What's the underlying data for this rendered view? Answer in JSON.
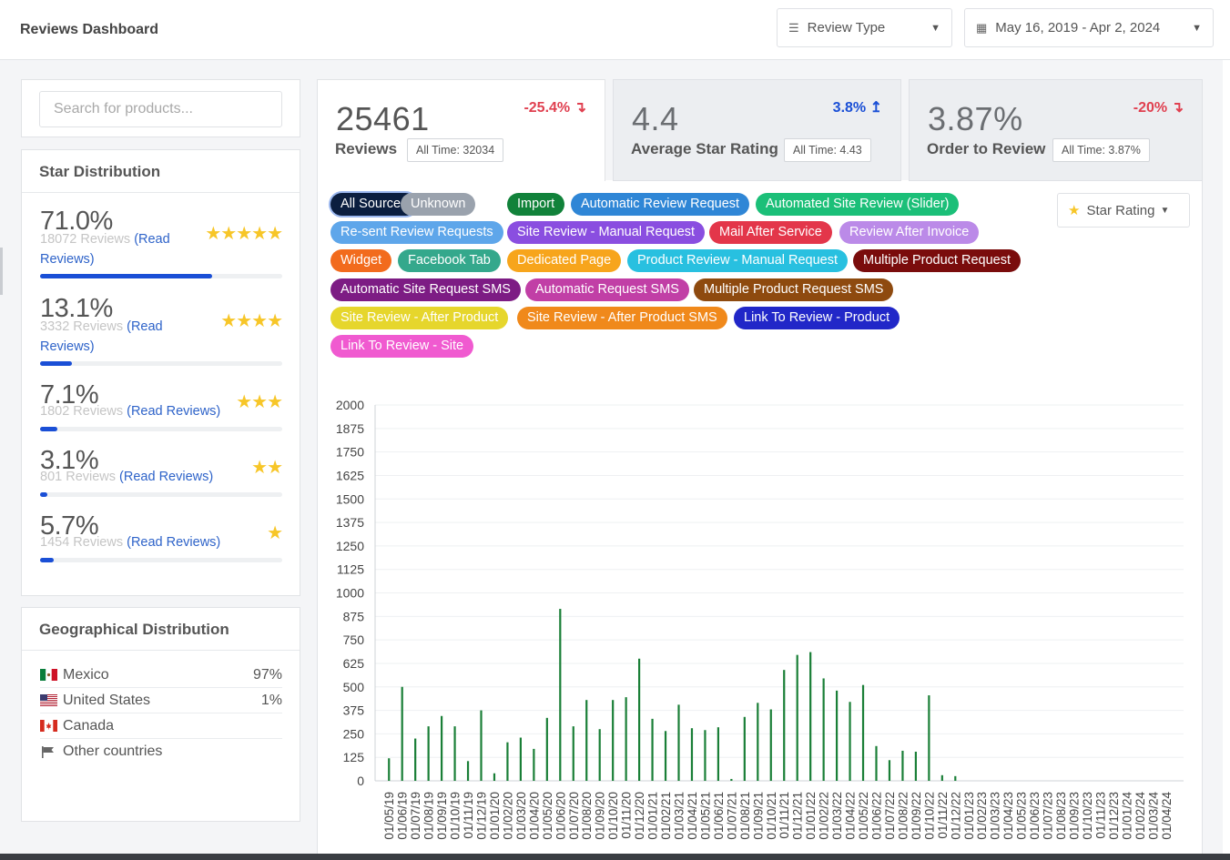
{
  "header": {
    "title": "Reviews Dashboard",
    "review_type_label": "Review Type",
    "date_range": "May 16, 2019 - Apr 2, 2024"
  },
  "search": {
    "placeholder": "Search for products..."
  },
  "star_distribution": {
    "title": "Star Distribution",
    "rows": [
      {
        "pct": "71.0%",
        "count": "18072 Reviews",
        "link": "(Read Reviews)",
        "stars": 5,
        "fill": 0.71
      },
      {
        "pct": "13.1%",
        "count": "3332 Reviews",
        "link": "(Read Reviews)",
        "stars": 4,
        "fill": 0.131
      },
      {
        "pct": "7.1%",
        "count": "1802 Reviews",
        "link": "(Read Reviews)",
        "stars": 3,
        "fill": 0.071
      },
      {
        "pct": "3.1%",
        "count": "801 Reviews",
        "link": "(Read Reviews)",
        "stars": 2,
        "fill": 0.031
      },
      {
        "pct": "5.7%",
        "count": "1454 Reviews",
        "link": "(Read Reviews)",
        "stars": 1,
        "fill": 0.057
      }
    ]
  },
  "geo": {
    "title": "Geographical Distribution",
    "rows": [
      {
        "country": "Mexico",
        "pct": "97%",
        "flag": "mexico-flag"
      },
      {
        "country": "United States",
        "pct": "1%",
        "flag": "us-flag"
      },
      {
        "country": "Canada",
        "pct": "",
        "flag": "canada-flag"
      },
      {
        "country": "Other countries",
        "pct": "",
        "flag": "generic-flag"
      }
    ]
  },
  "stats": [
    {
      "value": "25461",
      "label": "Reviews",
      "all_time": "All Time: 32034",
      "change": "-25.4% ↴",
      "dir": "neg"
    },
    {
      "value": "4.4",
      "label": "Average Star Rating",
      "all_time": "All Time: 4.43",
      "change": "3.8% ↥",
      "dir": "pos"
    },
    {
      "value": "3.87%",
      "label": "Order to Review",
      "all_time": "All Time: 3.87%",
      "change": "-20% ↴",
      "dir": "neg"
    }
  ],
  "sources": [
    {
      "label": "All Sources",
      "color": "#0b1e3f",
      "selected": true
    },
    {
      "label": "Unknown",
      "color": "#9aa2ad"
    },
    {
      "label": "Import",
      "color": "#11823a"
    },
    {
      "label": "Automatic Review Request",
      "color": "#2f86d6"
    },
    {
      "label": "Automated Site Review (Slider)",
      "color": "#1bbf78"
    },
    {
      "label": "Re-sent Review Requests",
      "color": "#5ea6ea"
    },
    {
      "label": "Site Review - Manual Request",
      "color": "#8a4ee0"
    },
    {
      "label": "Mail After Service",
      "color": "#e3364a"
    },
    {
      "label": "Review After Invoice",
      "color": "#bb8ae8"
    },
    {
      "label": "Widget",
      "color": "#f26b1d"
    },
    {
      "label": "Facebook Tab",
      "color": "#34a88c"
    },
    {
      "label": "Dedicated Page",
      "color": "#f7a51c"
    },
    {
      "label": "Product Review - Manual Request",
      "color": "#28c0e0"
    },
    {
      "label": "Multiple Product Request",
      "color": "#7a0c0c"
    },
    {
      "label": "Automatic Site Request SMS",
      "color": "#7d1c84"
    },
    {
      "label": "Automatic Request SMS",
      "color": "#c13fa6"
    },
    {
      "label": "Multiple Product Request SMS",
      "color": "#8e4a0f"
    },
    {
      "label": "Site Review - After Product",
      "color": "#e6d62c"
    },
    {
      "label": "Site Review - After Product SMS",
      "color": "#f0891b"
    },
    {
      "label": "Link To Review - Product",
      "color": "#2127c8"
    },
    {
      "label": "Link To Review - Site",
      "color": "#f05ad0"
    }
  ],
  "star_rating_label": "Star Rating",
  "chart_data": {
    "type": "bar",
    "stacked": true,
    "ylim": [
      0,
      2000
    ],
    "yticks": [
      0,
      125,
      250,
      375,
      500,
      625,
      750,
      875,
      1000,
      1125,
      1250,
      1375,
      1500,
      1625,
      1750,
      1875,
      2000
    ],
    "categories": [
      "01/05/19",
      "01/06/19",
      "01/07/19",
      "01/08/19",
      "01/09/19",
      "01/10/19",
      "01/11/19",
      "01/12/19",
      "01/01/20",
      "01/02/20",
      "01/03/20",
      "01/04/20",
      "01/05/20",
      "01/06/20",
      "01/07/20",
      "01/08/20",
      "01/09/20",
      "01/10/20",
      "01/11/20",
      "01/12/20",
      "01/01/21",
      "01/02/21",
      "01/03/21",
      "01/04/21",
      "01/05/21",
      "01/06/21",
      "01/07/21",
      "01/08/21",
      "01/09/21",
      "01/10/21",
      "01/11/21",
      "01/12/21",
      "01/01/22",
      "01/02/22",
      "01/03/22",
      "01/04/22",
      "01/05/22",
      "01/06/22",
      "01/07/22",
      "01/08/22",
      "01/09/22",
      "01/10/22",
      "01/11/22",
      "01/12/22",
      "01/01/23",
      "01/02/23",
      "01/03/23",
      "01/04/23",
      "01/05/23",
      "01/06/23",
      "01/07/23",
      "01/08/23",
      "01/09/23",
      "01/10/23",
      "01/11/23",
      "01/12/23",
      "01/01/24",
      "01/02/24",
      "01/03/24",
      "01/04/24"
    ],
    "series": [
      {
        "color": "#1a7f37",
        "values": [
          120,
          500,
          225,
          290,
          345,
          290,
          105,
          375,
          40,
          205,
          230,
          170,
          335,
          915,
          290,
          430,
          275,
          430,
          445,
          650,
          330,
          265,
          405,
          280,
          270,
          285,
          10,
          340,
          415,
          380,
          590,
          670,
          685,
          545,
          480,
          420,
          510,
          185,
          110,
          160,
          155,
          455,
          30,
          25,
          0,
          0,
          0,
          0,
          0,
          0,
          0,
          0,
          0,
          0,
          0,
          0,
          0,
          0,
          0,
          0
        ]
      },
      {
        "color": "#e6cf1f",
        "values": [
          0,
          0,
          0,
          0,
          0,
          0,
          0,
          0,
          0,
          0,
          0,
          0,
          0,
          0,
          0,
          0,
          0,
          0,
          0,
          0,
          0,
          0,
          0,
          0,
          0,
          0,
          0,
          0,
          0,
          0,
          0,
          0,
          0,
          0,
          0,
          0,
          0,
          0,
          0,
          0,
          0,
          0,
          0,
          0,
          0,
          0,
          0,
          0,
          0,
          0,
          0,
          0,
          0,
          0,
          0,
          0,
          0,
          0,
          0,
          0
        ]
      },
      {
        "color": "#8c1010",
        "values": [
          0,
          0,
          0,
          0,
          0,
          0,
          0,
          0,
          0,
          0,
          0,
          0,
          0,
          0,
          0,
          0,
          0,
          0,
          0,
          0,
          0,
          0,
          0,
          0,
          0,
          0,
          0,
          0,
          0,
          0,
          0,
          0,
          0,
          0,
          0,
          0,
          0,
          0,
          0,
          0,
          0,
          0,
          0,
          0,
          0,
          0,
          0,
          0,
          0,
          0,
          0,
          0,
          0,
          0,
          0,
          0,
          0,
          0,
          0,
          0
        ]
      },
      {
        "color": "#3f86d4",
        "values": [
          0,
          0,
          0,
          0,
          0,
          0,
          0,
          0,
          0,
          0,
          0,
          0,
          0,
          0,
          0,
          0,
          0,
          0,
          0,
          0,
          0,
          0,
          0,
          0,
          0,
          0,
          0,
          0,
          0,
          0,
          0,
          0,
          0,
          0,
          0,
          0,
          0,
          0,
          0,
          0,
          0,
          0,
          0,
          0,
          0,
          0,
          0,
          0,
          0,
          0,
          0,
          0,
          0,
          0,
          0,
          0,
          0,
          0,
          0,
          0
        ]
      }
    ]
  }
}
